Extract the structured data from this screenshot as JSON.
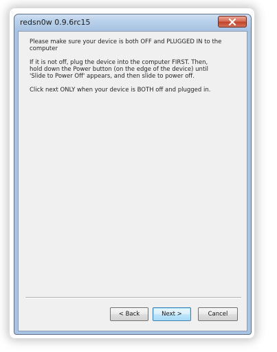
{
  "window": {
    "title": "redsn0w 0.9.6rc15"
  },
  "icons": {
    "close": "close-icon"
  },
  "instructions": {
    "para1": "Please make sure your device is both OFF and PLUGGED IN to the\ncomputer",
    "para2": "If it is not off, plug the device into the computer FIRST. Then,\nhold down the Power button (on the edge of the device) until\n'Slide to Power Off' appears, and then slide to power off.",
    "para3": "Click next ONLY when your device is BOTH off and plugged in."
  },
  "buttons": {
    "back": "< Back",
    "next": "Next >",
    "cancel": "Cancel"
  },
  "colors": {
    "close_button": "#c0442a",
    "title_bar": "#a9c4e3",
    "client_background": "#f0f0f0"
  }
}
